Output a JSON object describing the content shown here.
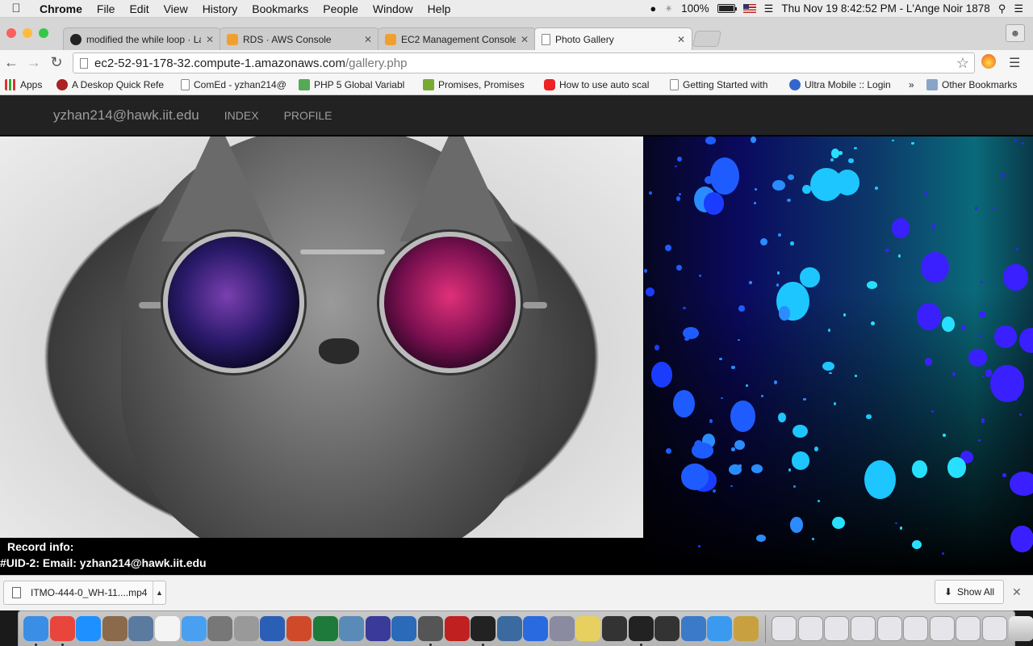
{
  "menubar": {
    "app": "Chrome",
    "items": [
      "File",
      "Edit",
      "View",
      "History",
      "Bookmarks",
      "People",
      "Window",
      "Help"
    ],
    "battery": "100%",
    "battery_level": 1.0,
    "datetime": "Thu Nov 19  8:42:52 PM - L'Ange Noir 1878"
  },
  "tabs": [
    {
      "title": "modified the while loop · La",
      "icon": "github-icon"
    },
    {
      "title": "RDS · AWS Console",
      "icon": "aws-cube-icon"
    },
    {
      "title": "EC2 Management Console",
      "icon": "aws-cube-icon"
    },
    {
      "title": "Photo Gallery",
      "icon": "page-icon",
      "active": true
    }
  ],
  "address": {
    "host": "ec2-52-91-178-32.compute-1.amazonaws.com",
    "path": "/gallery.php"
  },
  "bookmarks": [
    {
      "label": "Apps",
      "icon": "apps-grid-icon"
    },
    {
      "label": "A Deskop Quick Refe",
      "icon": "devil-icon"
    },
    {
      "label": "ComEd - yzhan214@",
      "icon": "page-icon"
    },
    {
      "label": "PHP 5 Global Variabl",
      "icon": "w3-icon"
    },
    {
      "label": "Promises, Promises",
      "icon": "promise-icon"
    },
    {
      "label": "How to use auto scal",
      "icon": "youtube-icon"
    },
    {
      "label": "Getting Started with",
      "icon": "page-icon"
    },
    {
      "label": "Ultra Mobile :: Login",
      "icon": "ultra-icon"
    },
    {
      "label": "»",
      "icon": ""
    },
    {
      "label": "Other Bookmarks",
      "icon": "folder-icon"
    }
  ],
  "site": {
    "brand": "yzhan214@hawk.iit.edu",
    "nav": [
      "INDEX",
      "PROFILE"
    ],
    "record_title": "Record info:",
    "record_line": "#UID-2: Email: yzhan214@hawk.iit.edu"
  },
  "downloads": {
    "file": "ITMO-444-0_WH-11....mp4",
    "show_all": "Show All"
  },
  "colors": {
    "navbar": "#222222",
    "nav_text": "#9d9d9d",
    "page_bg": "#000000"
  }
}
